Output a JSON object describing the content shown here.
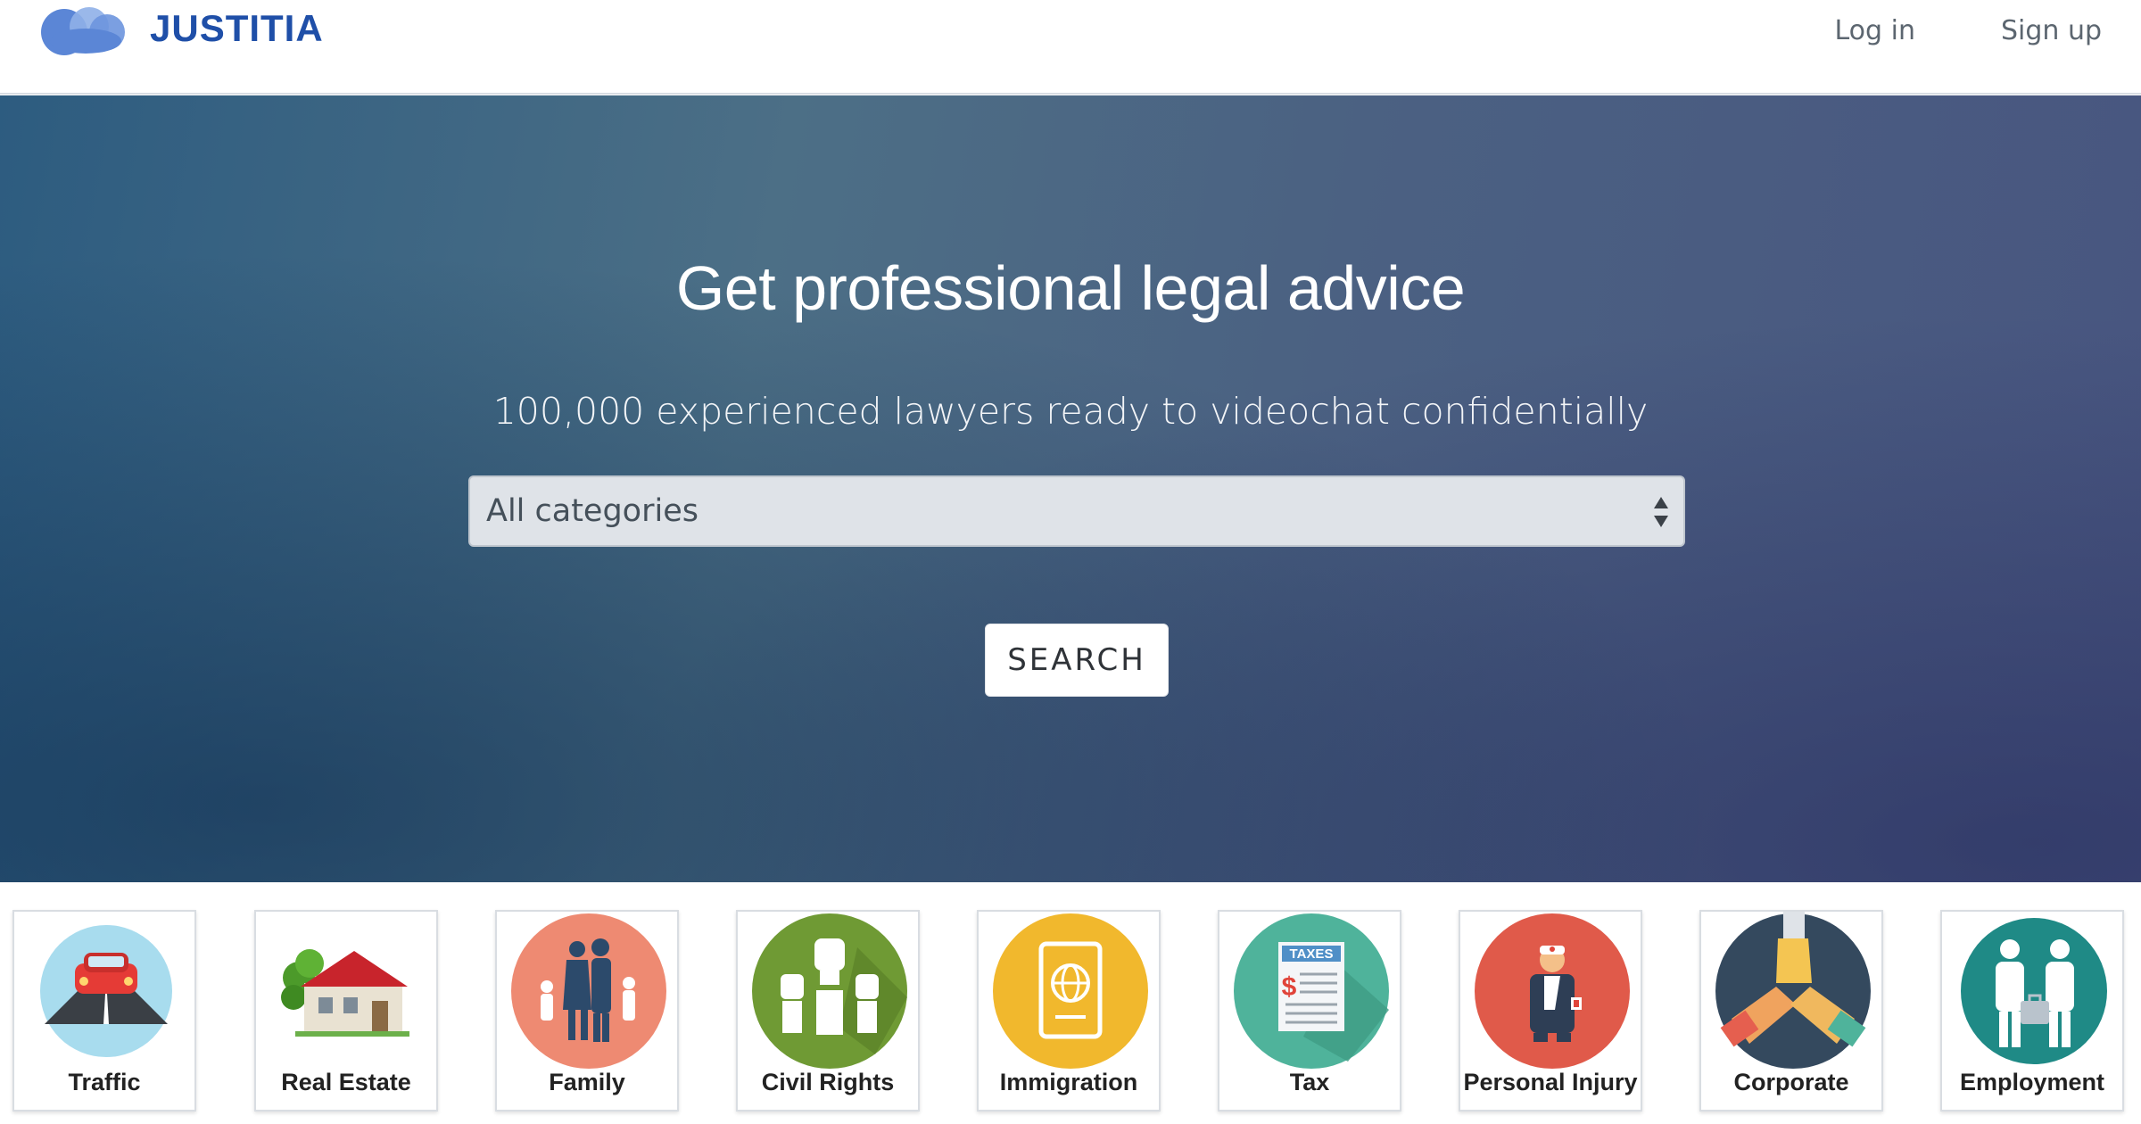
{
  "brand": {
    "name": "JUSTITIA",
    "logo_icon": "cloud-logo-icon",
    "color": "#1f4fa8"
  },
  "nav": {
    "login_label": "Log in",
    "signup_label": "Sign up"
  },
  "hero": {
    "title": "Get professional legal advice",
    "subtitle": "100,000 experienced lawyers ready to videochat confidentially",
    "category_select": {
      "selected": "All categories",
      "icon": "select-arrows-icon"
    },
    "search_label": "SEARCH"
  },
  "categories": [
    {
      "label": "Traffic",
      "icon": "car-road-icon",
      "color": "#a8dcee"
    },
    {
      "label": "Real Estate",
      "icon": "house-icon",
      "color": "#ffffff"
    },
    {
      "label": "Family",
      "icon": "family-icon",
      "color": "#ee8a72"
    },
    {
      "label": "Civil Rights",
      "icon": "raised-fists-icon",
      "color": "#6f9a34"
    },
    {
      "label": "Immigration",
      "icon": "passport-icon",
      "color": "#f1b82d"
    },
    {
      "label": "Tax",
      "icon": "tax-document-icon",
      "color": "#4fb39b"
    },
    {
      "label": "Personal Injury",
      "icon": "injured-person-icon",
      "color": "#e05a4a"
    },
    {
      "label": "Corporate",
      "icon": "handshake-icon",
      "color": "#34495e"
    },
    {
      "label": "Employment",
      "icon": "employees-icon",
      "color": "#1f8a86"
    }
  ]
}
